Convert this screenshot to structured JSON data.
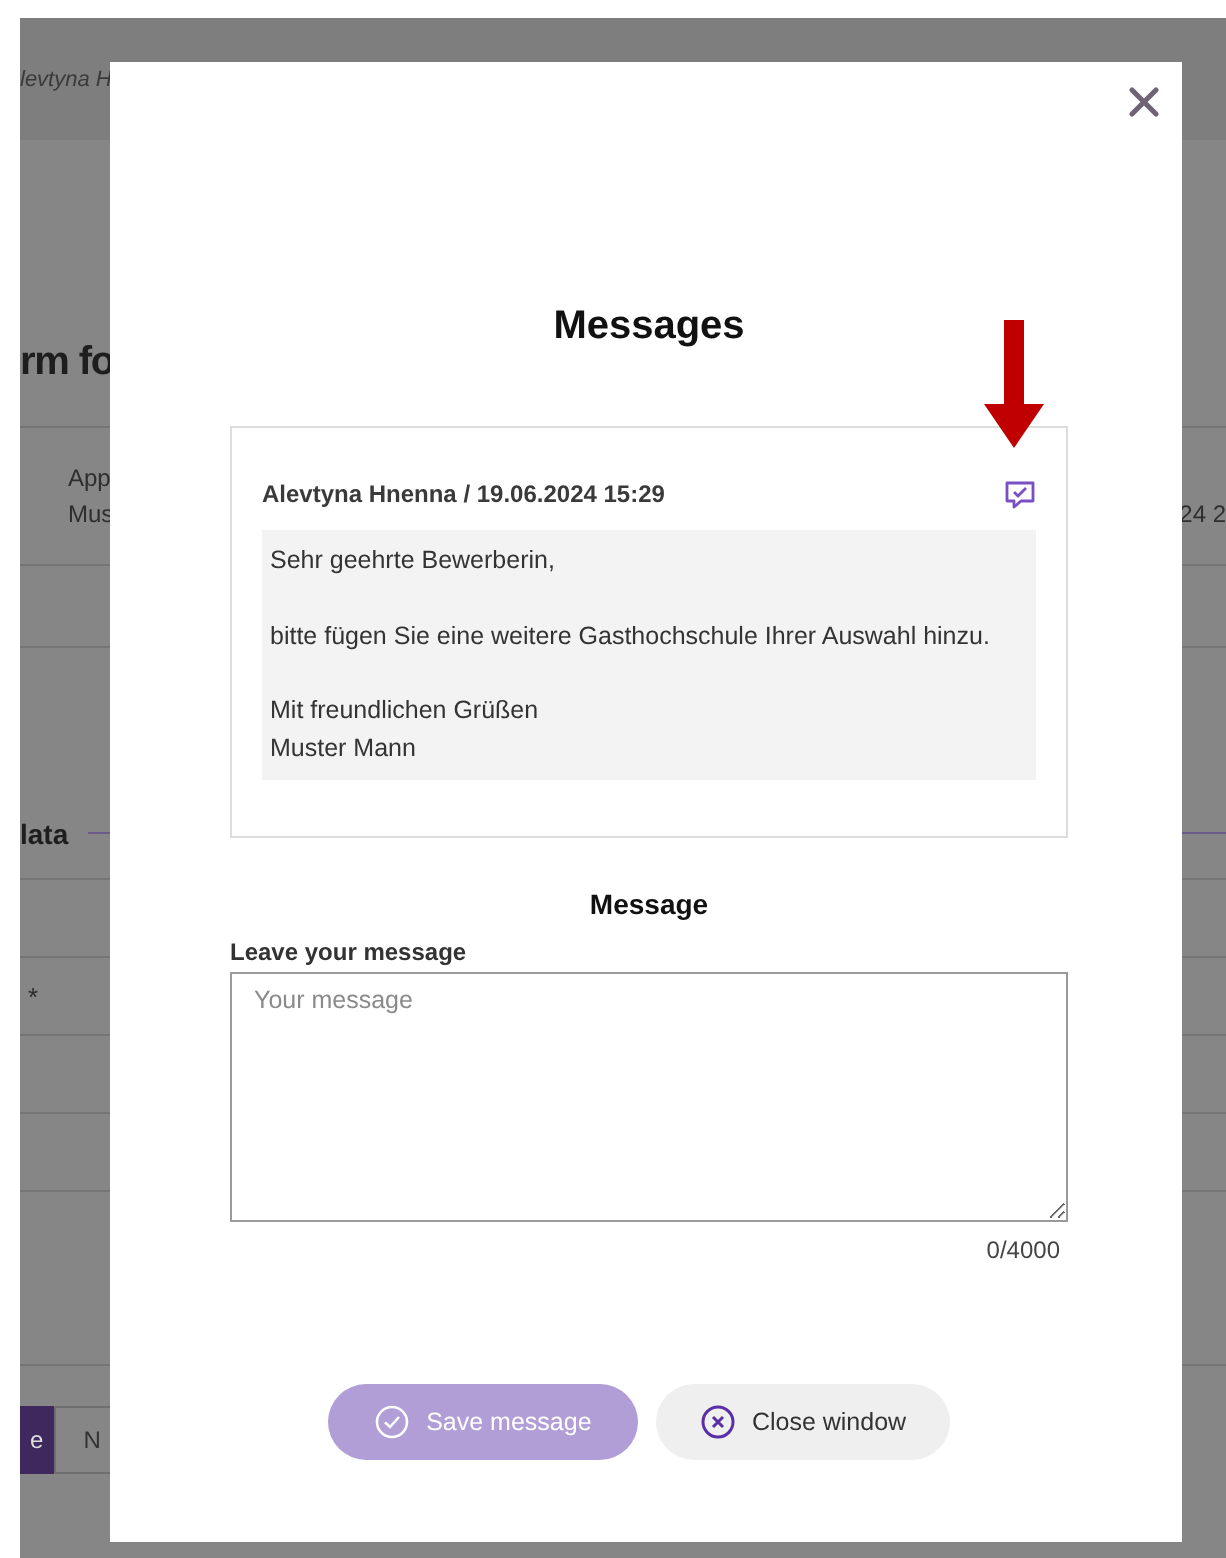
{
  "background": {
    "header_text": "levtyna H",
    "title": "rm fo",
    "field_label": "App",
    "field_value": "Mus",
    "right_value": "24 2",
    "section": "lata",
    "required_mark": "*",
    "buttons": [
      {
        "label": "e",
        "kind": "primary"
      },
      {
        "label": "N",
        "kind": "outline"
      }
    ]
  },
  "dialog": {
    "title": "Messages",
    "messages": [
      {
        "author_date": "Alevtyna Hnenna / 19.06.2024 15:29",
        "text": "Sehr geehrte Bewerberin,\n\nbitte fügen Sie eine weitere Gasthochschule Ihrer Auswahl hinzu.\n\nMit freundlichen Grüßen\nMuster Mann"
      }
    ],
    "compose": {
      "heading": "Message",
      "label": "Leave your message",
      "placeholder": "Your message",
      "counter": "0/4000"
    },
    "buttons": [
      {
        "label": "Save message",
        "kind": "save",
        "disabled": true
      },
      {
        "label": "Close window",
        "kind": "close"
      }
    ]
  }
}
